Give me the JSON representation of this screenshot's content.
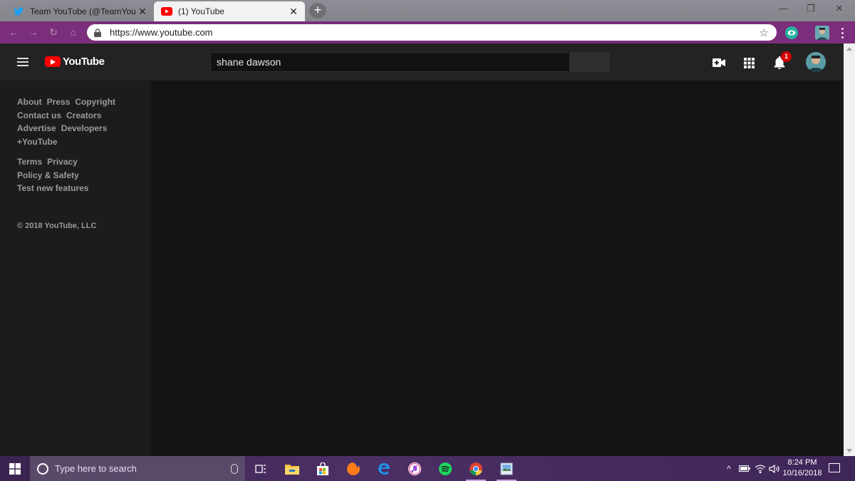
{
  "browser": {
    "tabs": [
      {
        "title": "Team YouTube (@TeamYouTube)",
        "favicon": "twitter-bird-icon",
        "active": false
      },
      {
        "title": "(1) YouTube",
        "favicon": "youtube-icon",
        "active": true
      }
    ],
    "new_tab_label": "+",
    "close_glyph": "✕",
    "url": "https://www.youtube.com",
    "theme_color": "#7b2e7b"
  },
  "youtube": {
    "logo_text": "YouTube",
    "search_value": "shane dawson",
    "notification_count": "1",
    "footer": {
      "group1": [
        [
          "About",
          "Press",
          "Copyright"
        ],
        [
          "Contact us",
          "Creators"
        ],
        [
          "Advertise",
          "Developers"
        ],
        [
          "+YouTube"
        ]
      ],
      "group2": [
        [
          "Terms",
          "Privacy"
        ],
        [
          "Policy & Safety"
        ],
        [
          "Test new features"
        ]
      ],
      "copyright": "© 2018 YouTube, LLC"
    }
  },
  "taskbar": {
    "search_placeholder": "Type here to search",
    "apps": [
      "task-view-icon",
      "file-explorer-icon",
      "store-icon",
      "firefox-icon",
      "edge-icon",
      "itunes-icon",
      "spotify-icon",
      "chrome-icon",
      "photos-icon"
    ],
    "time": "8:24 PM",
    "date": "10/16/2018"
  }
}
